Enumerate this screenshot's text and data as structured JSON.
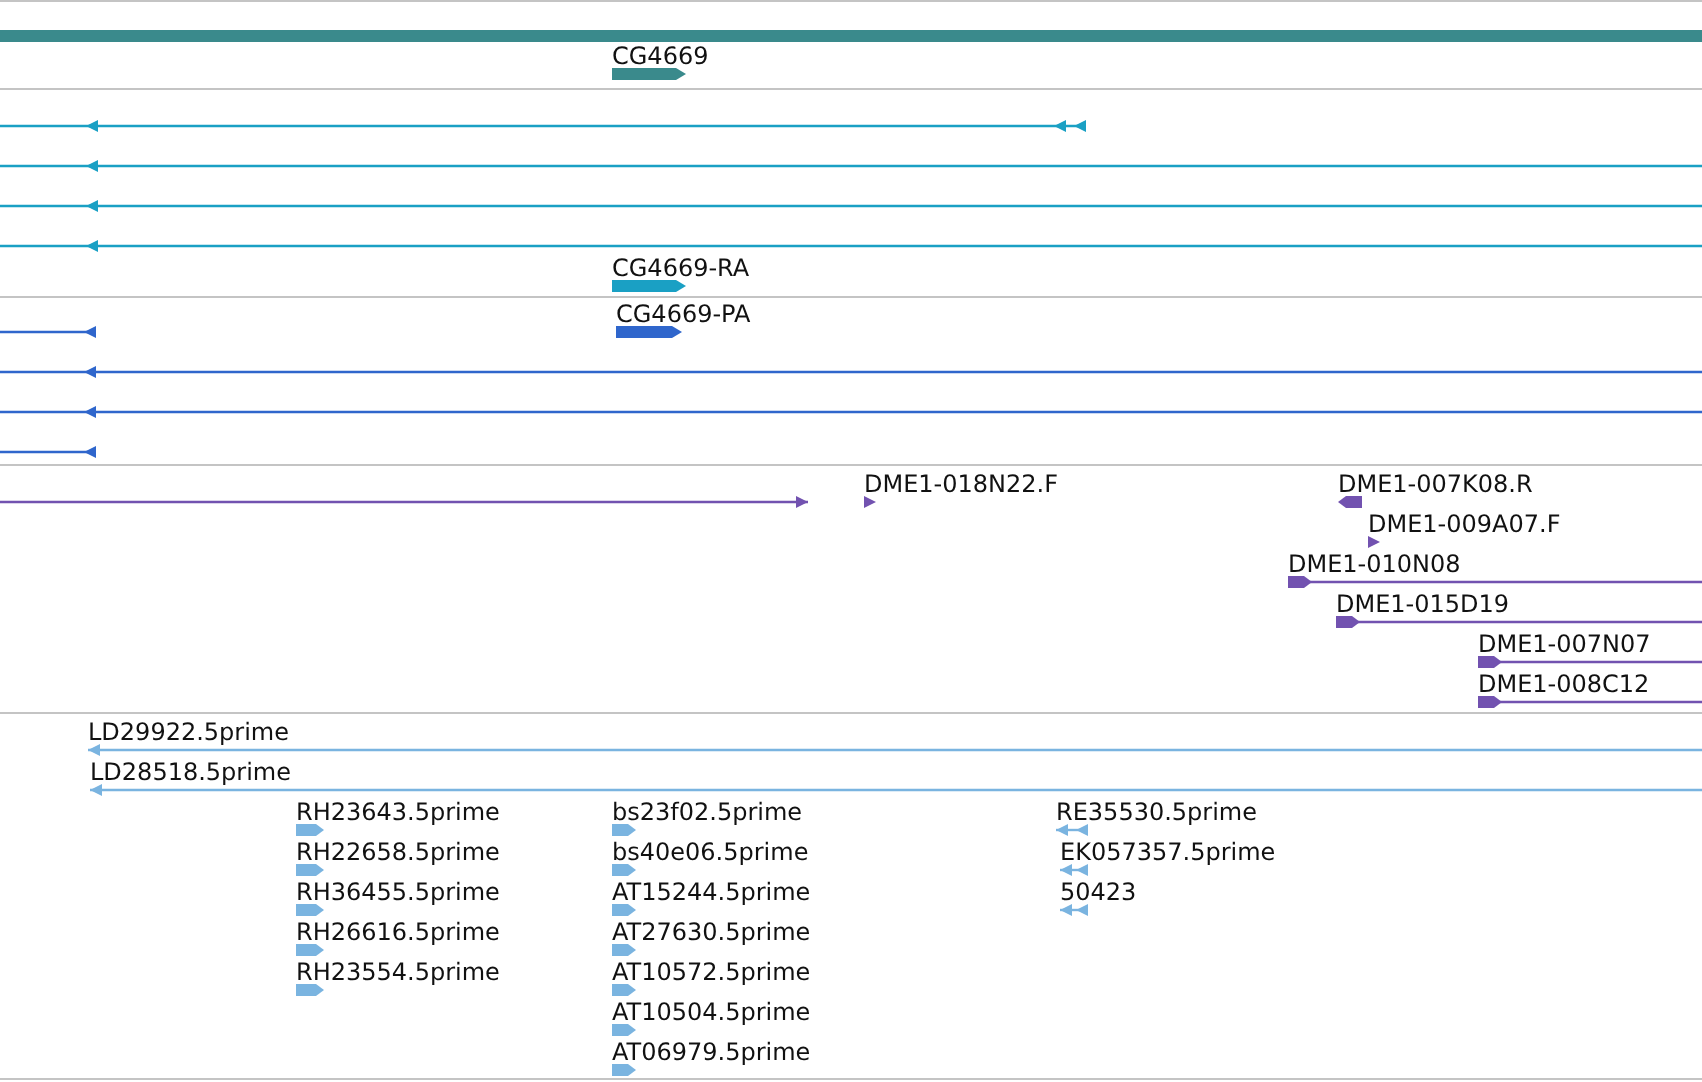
{
  "tracks": [
    {
      "color": "#3a8a8c",
      "features": [
        {
          "kind": "span-bar"
        },
        {
          "kind": "gene",
          "label": "CG4669"
        }
      ]
    },
    {
      "color": "#1aa0c4",
      "features": [
        {
          "kind": "line-left"
        },
        {
          "kind": "line-left"
        },
        {
          "kind": "line-left"
        },
        {
          "kind": "line-left"
        },
        {
          "kind": "gene",
          "label": "CG4669-RA"
        }
      ]
    },
    {
      "color": "#2f66cc",
      "features": [
        {
          "kind": "gene",
          "label": "CG4669-PA"
        },
        {
          "kind": "line-left"
        },
        {
          "kind": "line-left"
        },
        {
          "kind": "line-left"
        },
        {
          "kind": "line-left"
        }
      ]
    },
    {
      "color": "#7252b0",
      "features": [
        {
          "kind": "line-right"
        },
        {
          "kind": "tri-right",
          "label": "DME1-018N22.F"
        },
        {
          "kind": "block-left",
          "label": "DME1-007K08.R"
        },
        {
          "kind": "tri-right",
          "label": "DME1-009A07.F"
        },
        {
          "kind": "read-right",
          "label": "DME1-010N08"
        },
        {
          "kind": "read-right",
          "label": "DME1-015D19"
        },
        {
          "kind": "read-right",
          "label": "DME1-007N07"
        },
        {
          "kind": "read-right",
          "label": "DME1-008C12"
        }
      ]
    },
    {
      "color": "#7ab4e0",
      "features": [
        {
          "kind": "line-left",
          "label": "LD29922.5prime"
        },
        {
          "kind": "line-left",
          "label": "LD28518.5prime"
        },
        {
          "kind": "est-right",
          "label": "RH23643.5prime"
        },
        {
          "kind": "est-right",
          "label": "RH22658.5prime"
        },
        {
          "kind": "est-right",
          "label": "RH36455.5prime"
        },
        {
          "kind": "est-right",
          "label": "RH26616.5prime"
        },
        {
          "kind": "est-right",
          "label": "RH23554.5prime"
        },
        {
          "kind": "est-right",
          "label": "bs23f02.5prime"
        },
        {
          "kind": "est-right",
          "label": "bs40e06.5prime"
        },
        {
          "kind": "est-right",
          "label": "AT15244.5prime"
        },
        {
          "kind": "est-right",
          "label": "AT27630.5prime"
        },
        {
          "kind": "est-right",
          "label": "AT10572.5prime"
        },
        {
          "kind": "est-right",
          "label": "AT10504.5prime"
        },
        {
          "kind": "est-right",
          "label": "AT06979.5prime"
        },
        {
          "kind": "est-left",
          "label": "RE35530.5prime"
        },
        {
          "kind": "est-left",
          "label": "EK057357.5prime"
        },
        {
          "kind": "est-left",
          "label": "50423"
        }
      ]
    }
  ]
}
